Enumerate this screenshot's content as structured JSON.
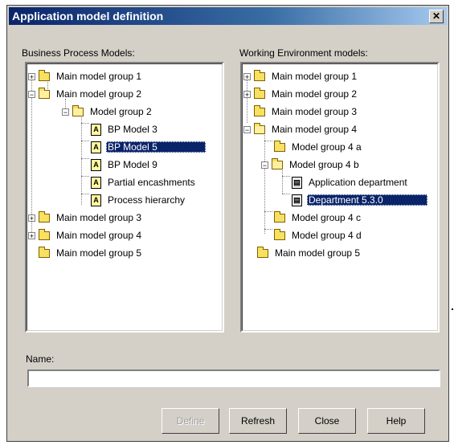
{
  "window": {
    "title": "Application model definition",
    "close_glyph": "✕"
  },
  "left_panel": {
    "label": "Business Process Models:",
    "items": [
      {
        "label": "Main model group 1",
        "expander": "+",
        "icon": "folder-icon"
      },
      {
        "label": "Main model group 2",
        "expander": "−",
        "icon": "folder-open-icon"
      },
      {
        "label": "Model group 2",
        "expander": "−",
        "icon": "folder-open-icon"
      },
      {
        "label": "BP Model 3",
        "icon": "model-document-icon"
      },
      {
        "label": "BP Model 5",
        "icon": "model-document-icon",
        "selected": true
      },
      {
        "label": "BP Model 9",
        "icon": "model-document-icon"
      },
      {
        "label": "Partial encashments",
        "icon": "model-document-icon"
      },
      {
        "label": "Process hierarchy",
        "icon": "model-document-icon"
      },
      {
        "label": "Main model group 3",
        "expander": "+",
        "icon": "folder-icon"
      },
      {
        "label": "Main model group 4",
        "expander": "+",
        "icon": "folder-icon"
      },
      {
        "label": "Main model group 5",
        "icon": "folder-icon"
      }
    ]
  },
  "right_panel": {
    "label": "Working Environment models:",
    "items": [
      {
        "label": "Main model group 1",
        "expander": "+",
        "icon": "folder-icon"
      },
      {
        "label": "Main model group 2",
        "expander": "+",
        "icon": "folder-icon"
      },
      {
        "label": "Main model group 3",
        "icon": "folder-icon"
      },
      {
        "label": "Main model group 4",
        "expander": "−",
        "icon": "folder-open-icon"
      },
      {
        "label": "Model group 4 a",
        "icon": "folder-icon"
      },
      {
        "label": "Model group 4 b",
        "expander": "−",
        "icon": "folder-open-icon"
      },
      {
        "label": "Application department",
        "icon": "department-icon"
      },
      {
        "label": "Department 5.3.0",
        "icon": "department-icon",
        "selected": true
      },
      {
        "label": "Model group 4 c",
        "icon": "folder-icon"
      },
      {
        "label": "Model group 4 d",
        "icon": "folder-icon"
      },
      {
        "label": "Main model group 5",
        "icon": "folder-icon"
      }
    ]
  },
  "name_field": {
    "label": "Name:",
    "value": ""
  },
  "buttons": {
    "define": "Define",
    "refresh": "Refresh",
    "close": "Close",
    "help": "Help"
  }
}
